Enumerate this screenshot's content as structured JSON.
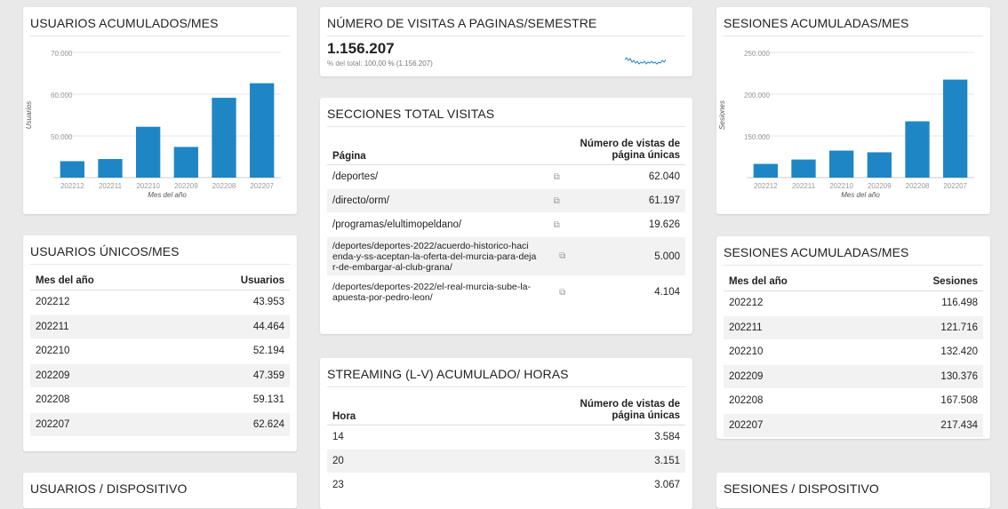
{
  "colors": {
    "accent": "#1f86c6",
    "background": "#e9e9e9"
  },
  "usuarios_acumulados": {
    "title": "USUARIOS ACUMULADOS/MES",
    "chart_data": {
      "type": "bar",
      "title": "",
      "xlabel": "Mes del año",
      "ylabel": "Usuarios",
      "categories": [
        "202212",
        "202211",
        "202210",
        "202209",
        "202208",
        "202207"
      ],
      "values": [
        43953,
        44464,
        52194,
        47359,
        59131,
        62624
      ],
      "ylim": [
        40000,
        70000
      ],
      "yticks": [
        70000,
        60000,
        50000
      ],
      "ytick_labels": [
        "70.000",
        "60.000",
        "50.000"
      ],
      "grid": true
    }
  },
  "visitas": {
    "title": "NÚMERO DE VISITAS A PAGINAS/SEMESTRE",
    "total": "1.156.207",
    "subtitle_prefix": "% del total: ",
    "subtitle_value": "100,00 % (1.156.207)"
  },
  "secciones": {
    "title": "SECCIONES TOTAL VISITAS",
    "col1": "Página",
    "col2_line1": "Número de vistas de",
    "col2_line2": "página únicas",
    "rows": [
      {
        "page": "/deportes/",
        "value": "62.040"
      },
      {
        "page": "/directo/orm/",
        "value": "61.197"
      },
      {
        "page": "/programas/elultimopeldano/",
        "value": "19.626"
      },
      {
        "page_line1": "/deportes/deportes-2022/acuerdo-historico-haci",
        "page_line2": "enda-y-ss-aceptan-la-oferta-del-murcia-para-deja",
        "page_line3": "r-de-embargar-al-club-grana/",
        "value": "5.000"
      },
      {
        "page_line1": "/deportes/deportes-2022/el-real-murcia-sube-la-",
        "page_line2": "apuesta-por-pedro-leon/",
        "value": "4.104"
      }
    ]
  },
  "streaming": {
    "title": "STREAMING (L-V) ACUMULADO/ HORAS",
    "col1": "Hora",
    "col2_line1": "Número de vistas de",
    "col2_line2": "página únicas",
    "rows": [
      {
        "hora": "14",
        "value": "3.584"
      },
      {
        "hora": "20",
        "value": "3.151"
      },
      {
        "hora": "23",
        "value": "3.067"
      }
    ]
  },
  "usuarios_unicos": {
    "title": "USUARIOS ÚNICOS/MES",
    "col1": "Mes del año",
    "col2": "Usuarios",
    "rows": [
      {
        "mes": "202212",
        "value": "43.953"
      },
      {
        "mes": "202211",
        "value": "44.464"
      },
      {
        "mes": "202210",
        "value": "52.194"
      },
      {
        "mes": "202209",
        "value": "47.359"
      },
      {
        "mes": "202208",
        "value": "59.131"
      },
      {
        "mes": "202207",
        "value": "62.624"
      }
    ]
  },
  "usuarios_dispositivo": {
    "title": "USUARIOS / DISPOSITIVO"
  },
  "sesiones_acumuladas_chart": {
    "title": "SESIONES ACUMULADAS/MES",
    "chart_data": {
      "type": "bar",
      "title": "",
      "xlabel": "Mes del año",
      "ylabel": "Sesiones",
      "categories": [
        "202212",
        "202211",
        "202210",
        "202209",
        "202208",
        "202207"
      ],
      "values": [
        116498,
        121716,
        132420,
        130376,
        167508,
        217434
      ],
      "ylim": [
        100000,
        250000
      ],
      "yticks": [
        250000,
        200000,
        150000
      ],
      "ytick_labels": [
        "250.000",
        "200.000",
        "150.000"
      ],
      "grid": true
    }
  },
  "sesiones_acumuladas_table": {
    "title": "SESIONES ACUMULADAS/MES",
    "col1": "Mes del año",
    "col2": "Sesiones",
    "rows": [
      {
        "mes": "202212",
        "value": "116.498"
      },
      {
        "mes": "202211",
        "value": "121.716"
      },
      {
        "mes": "202210",
        "value": "132.420"
      },
      {
        "mes": "202209",
        "value": "130.376"
      },
      {
        "mes": "202208",
        "value": "167.508"
      },
      {
        "mes": "202207",
        "value": "217.434"
      }
    ]
  },
  "sesiones_dispositivo": {
    "title": "SESIONES / DISPOSITIVO"
  }
}
